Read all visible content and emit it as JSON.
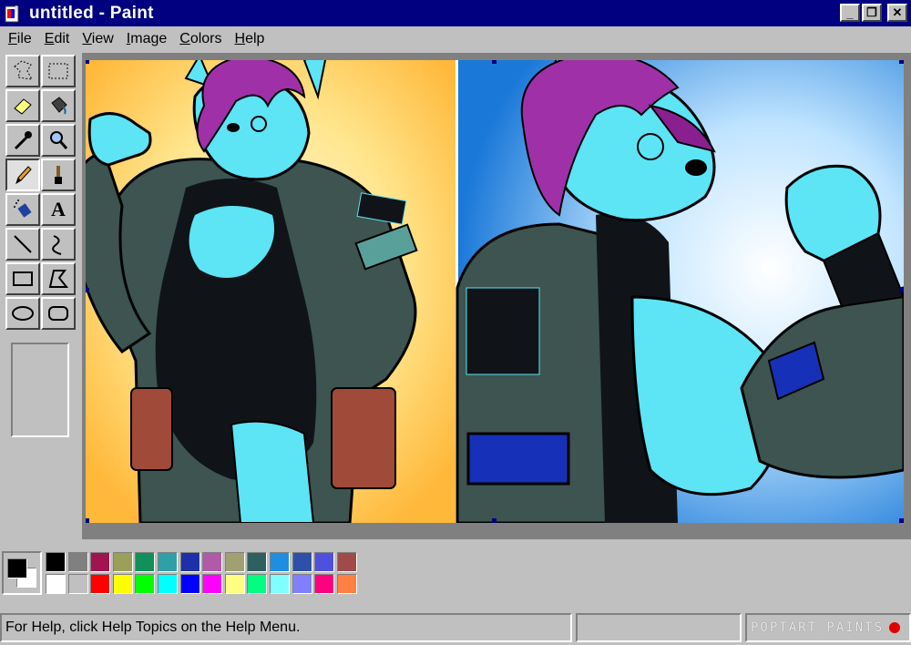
{
  "window": {
    "title": "untitled - Paint",
    "buttons": [
      "_",
      "❐",
      "✕"
    ]
  },
  "menu": [
    {
      "label": "File",
      "u": "F",
      "rest": "ile"
    },
    {
      "label": "Edit",
      "u": "E",
      "rest": "dit"
    },
    {
      "label": "View",
      "u": "V",
      "rest": "iew"
    },
    {
      "label": "Image",
      "u": "I",
      "rest": "mage"
    },
    {
      "label": "Colors",
      "u": "C",
      "rest": "olors"
    },
    {
      "label": "Help",
      "u": "H",
      "rest": "elp"
    }
  ],
  "tools": [
    {
      "name": "free-form-select-icon"
    },
    {
      "name": "select-icon"
    },
    {
      "name": "eraser-icon"
    },
    {
      "name": "fill-bucket-icon"
    },
    {
      "name": "color-picker-icon"
    },
    {
      "name": "magnifier-icon"
    },
    {
      "name": "pencil-icon"
    },
    {
      "name": "brush-icon"
    },
    {
      "name": "airbrush-icon"
    },
    {
      "name": "text-icon"
    },
    {
      "name": "line-icon"
    },
    {
      "name": "curve-icon"
    },
    {
      "name": "rectangle-icon"
    },
    {
      "name": "polygon-icon"
    },
    {
      "name": "ellipse-icon"
    },
    {
      "name": "rounded-rectangle-icon"
    }
  ],
  "text_tool_glyph": "A",
  "palette": {
    "foreground": "#000000",
    "background": "#ffffff",
    "row1": [
      "#000000",
      "#808080",
      "#a0154f",
      "#9aa05a",
      "#10905a",
      "#2fa0a8",
      "#1e2fa8",
      "#b05aa8",
      "#a0a070",
      "#2f6060",
      "#1e8fe0",
      "#2f50a8",
      "#5050e0",
      "#a04a4a"
    ],
    "row2": [
      "#ffffff",
      "#c0c0c0",
      "#ff0000",
      "#ffff00",
      "#00ff00",
      "#00ffff",
      "#0000ff",
      "#ff00ff",
      "#ffff80",
      "#00ff80",
      "#80ffff",
      "#8080ff",
      "#ff0080",
      "#ff8040"
    ]
  },
  "status": {
    "help": "For Help, click Help Topics on the Help Menu.",
    "watermark": "POPTART PAINTS"
  }
}
